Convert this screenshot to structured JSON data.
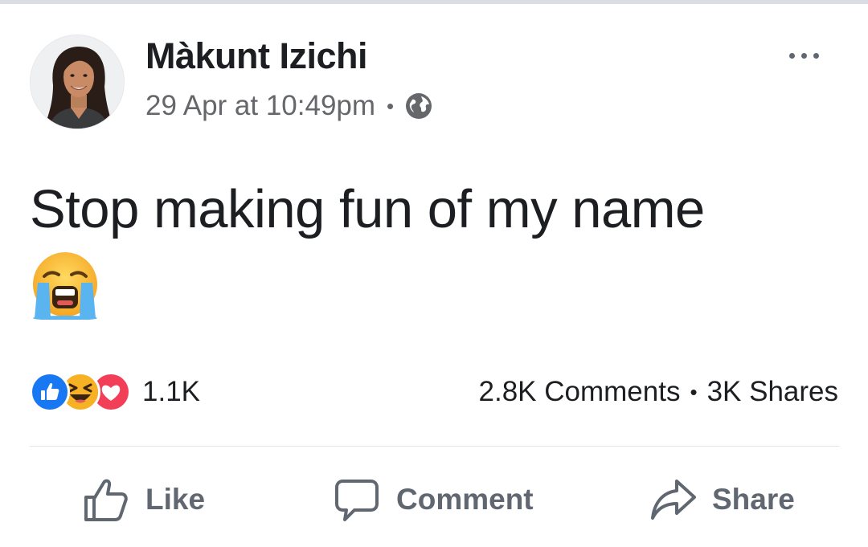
{
  "post": {
    "author": {
      "name": "Màkunt Izichi",
      "avatar_icon": "profile-photo"
    },
    "timestamp": "29 Apr at 10:49pm",
    "separator": "•",
    "privacy_icon": "globe-icon",
    "more_icon": "more-options-icon",
    "text": "Stop making fun of my name",
    "emoji_icon": "loudly-crying-face-emoji"
  },
  "stats": {
    "reaction_icons": [
      "like-reaction-icon",
      "haha-reaction-icon",
      "love-reaction-icon"
    ],
    "reaction_count": "1.1K",
    "comments": "2.8K Comments",
    "separator": "•",
    "shares": "3K Shares"
  },
  "actions": {
    "like_label": "Like",
    "comment_label": "Comment",
    "share_label": "Share"
  },
  "colors": {
    "text_primary": "#1c1e21",
    "text_secondary": "#65676b",
    "action_gray": "#606770",
    "like_blue": "#1877f2",
    "love_red": "#f33e58",
    "haha_yellow": "#f7b125",
    "divider": "#e4e6eb"
  }
}
